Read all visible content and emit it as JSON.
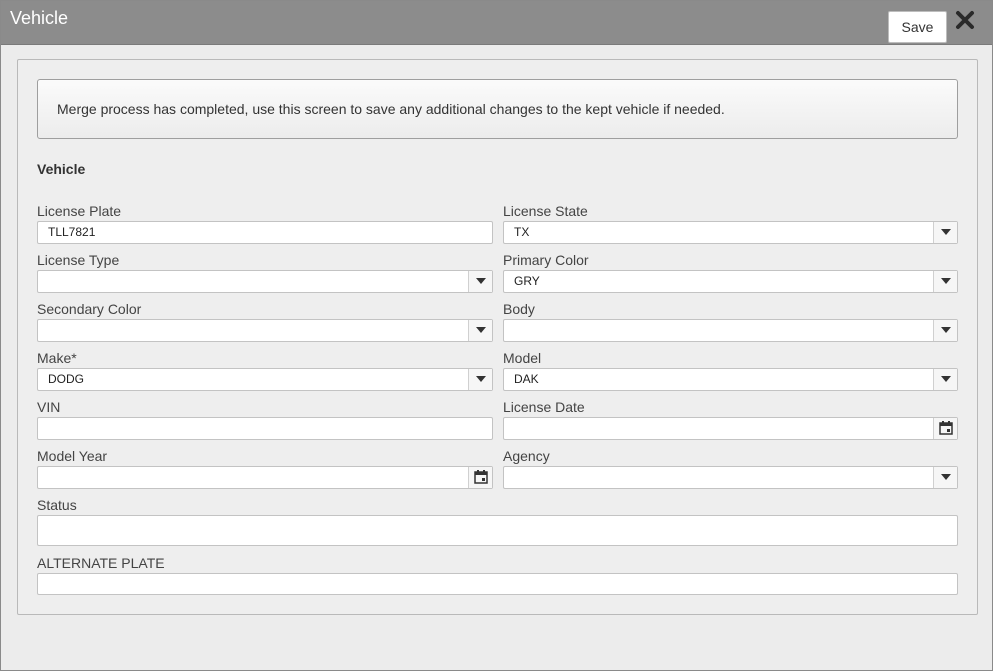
{
  "window": {
    "title": "Vehicle",
    "save_label": "Save",
    "close_icon": "close-icon"
  },
  "notice": {
    "text": "Merge process has completed, use this screen to save any additional changes to the kept vehicle if needed."
  },
  "section": {
    "title": "Vehicle"
  },
  "fields": {
    "license_plate": {
      "label": "License Plate",
      "value": "TLL7821"
    },
    "license_state": {
      "label": "License State",
      "value": "TX"
    },
    "license_type": {
      "label": "License Type",
      "value": ""
    },
    "primary_color": {
      "label": "Primary Color",
      "value": "GRY"
    },
    "secondary_color": {
      "label": "Secondary Color",
      "value": ""
    },
    "body": {
      "label": "Body",
      "value": ""
    },
    "make": {
      "label": "Make*",
      "value": "DODG"
    },
    "model": {
      "label": "Model",
      "value": "DAK"
    },
    "vin": {
      "label": "VIN",
      "value": ""
    },
    "license_date": {
      "label": "License Date",
      "value": ""
    },
    "model_year": {
      "label": "Model Year",
      "value": ""
    },
    "agency": {
      "label": "Agency",
      "value": ""
    },
    "status": {
      "label": "Status",
      "value": ""
    },
    "alternate_plate": {
      "label": "ALTERNATE PLATE",
      "value": ""
    }
  },
  "colors": {
    "titlebar": "#8c8c8c",
    "background": "#ececec"
  }
}
